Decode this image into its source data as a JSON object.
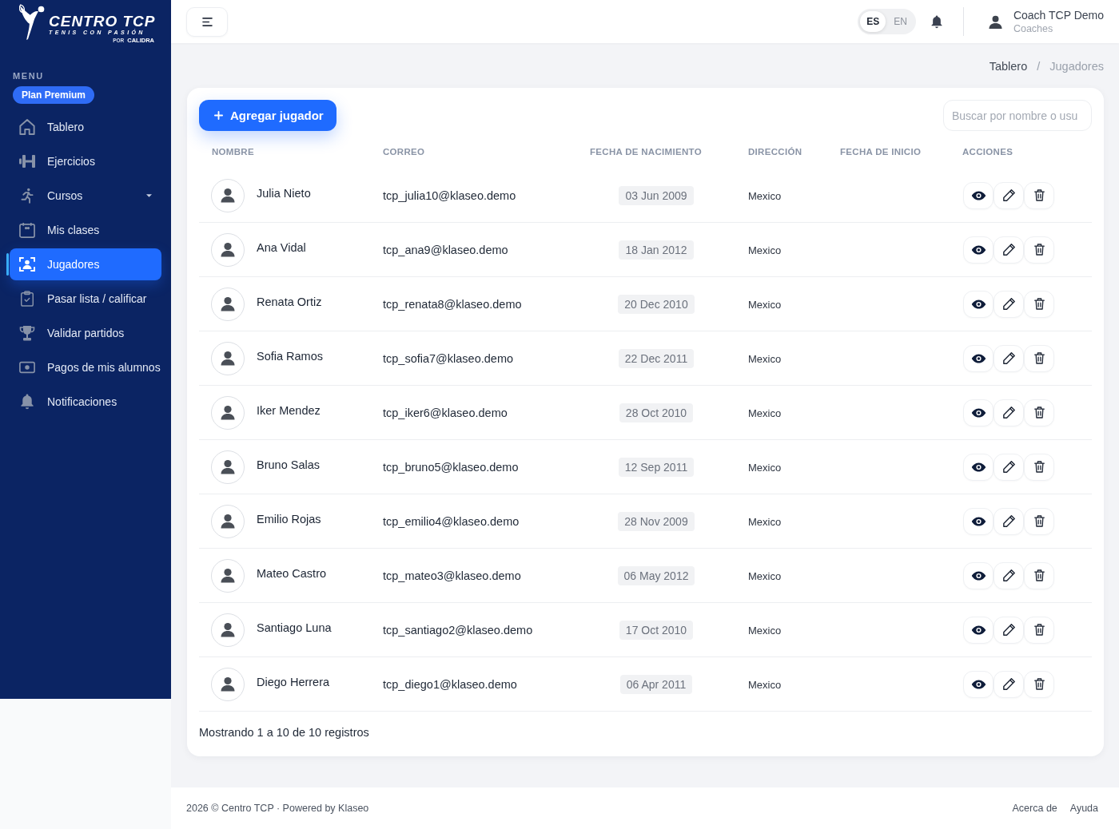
{
  "sidebar": {
    "logo": {
      "title": "CENTRO TCP",
      "tagline": "TENIS CON PASIÓN",
      "sponsor_prefix": "POR",
      "sponsor": "CALIDRA"
    },
    "section_label": "MENU",
    "plan_badge": "Plan Premium",
    "items": [
      {
        "label": "Tablero",
        "selected": false,
        "has_submenu": false
      },
      {
        "label": "Ejercicios",
        "selected": false,
        "has_submenu": false
      },
      {
        "label": "Cursos",
        "selected": false,
        "has_submenu": true
      },
      {
        "label": "Mis clases",
        "selected": false,
        "has_submenu": false
      },
      {
        "label": "Jugadores",
        "selected": true,
        "has_submenu": false
      },
      {
        "label": "Pasar lista / calificar",
        "selected": false,
        "has_submenu": false
      },
      {
        "label": "Validar partidos",
        "selected": false,
        "has_submenu": false
      },
      {
        "label": "Pagos de mis alumnos",
        "selected": false,
        "has_submenu": false
      },
      {
        "label": "Notificaciones",
        "selected": false,
        "has_submenu": false
      }
    ]
  },
  "header": {
    "language_options": [
      {
        "label": "ES",
        "selected": true
      },
      {
        "label": "EN",
        "selected": false
      }
    ],
    "user": {
      "name": "Coach TCP Demo",
      "role": "Coaches"
    }
  },
  "breadcrumb": {
    "separator": "/",
    "items": [
      {
        "label": "Tablero",
        "current": false
      },
      {
        "label": "Jugadores",
        "current": true
      }
    ]
  },
  "players_card": {
    "add_button": "Agregar jugador",
    "search": {
      "placeholder": "Buscar por nombre o usu"
    },
    "table": {
      "columns": [
        "NOMBRE",
        "CORREO",
        "FECHA DE NACIMIENTO",
        "DIRECCIÓN",
        "FECHA DE INICIO",
        "ACCIONES"
      ],
      "rows": [
        {
          "name": "Julia Nieto",
          "email": "tcp_julia10@klaseo.demo",
          "birth_date": "03 Jun 2009",
          "address": "Mexico"
        },
        {
          "name": "Ana Vidal",
          "email": "tcp_ana9@klaseo.demo",
          "birth_date": "18 Jan 2012",
          "address": "Mexico"
        },
        {
          "name": "Renata Ortiz",
          "email": "tcp_renata8@klaseo.demo",
          "birth_date": "20 Dec 2010",
          "address": "Mexico"
        },
        {
          "name": "Sofia Ramos",
          "email": "tcp_sofia7@klaseo.demo",
          "birth_date": "22 Dec 2011",
          "address": "Mexico"
        },
        {
          "name": "Iker Mendez",
          "email": "tcp_iker6@klaseo.demo",
          "birth_date": "28 Oct 2010",
          "address": "Mexico"
        },
        {
          "name": "Bruno Salas",
          "email": "tcp_bruno5@klaseo.demo",
          "birth_date": "12 Sep 2011",
          "address": "Mexico"
        },
        {
          "name": "Emilio Rojas",
          "email": "tcp_emilio4@klaseo.demo",
          "birth_date": "28 Nov 2009",
          "address": "Mexico"
        },
        {
          "name": "Mateo Castro",
          "email": "tcp_mateo3@klaseo.demo",
          "birth_date": "06 May 2012",
          "address": "Mexico"
        },
        {
          "name": "Santiago Luna",
          "email": "tcp_santiago2@klaseo.demo",
          "birth_date": "17 Oct 2010",
          "address": "Mexico"
        },
        {
          "name": "Diego Herrera",
          "email": "tcp_diego1@klaseo.demo",
          "birth_date": "06 Apr 2011",
          "address": "Mexico"
        }
      ]
    },
    "summary": "Mostrando 1 a 10 de 10 registros"
  },
  "footer": {
    "copyright": "2026 © Centro TCP · Powered by Klaseo",
    "links": [
      "Acerca de",
      "Ayuda"
    ]
  }
}
